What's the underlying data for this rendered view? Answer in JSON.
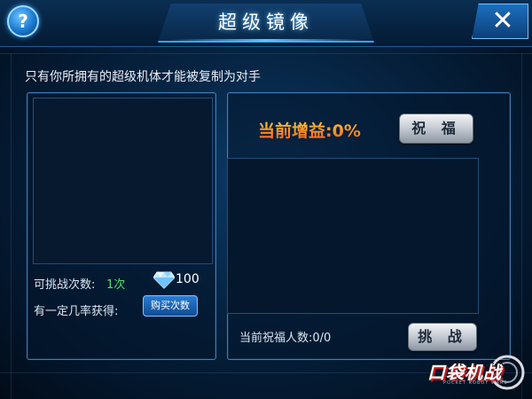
{
  "header": {
    "title": "超级镜像",
    "help_glyph": "?",
    "close_glyph": "✕"
  },
  "subtitle": "只有你所拥有的超级机体才能被复制为对手",
  "left_panel": {
    "challenge_count_label": "可挑战次数:",
    "challenge_count_value": "1次",
    "diamond_cost": "100",
    "probability_label": "有一定几率获得:",
    "buy_button_label": "购买次数"
  },
  "right_panel": {
    "gain_text": "当前增益:0%",
    "bless_button_label": "祝 福",
    "blessing_count_label": "当前祝福人数:0/0",
    "challenge_button_label": "挑 战"
  },
  "logo": {
    "title": "口袋机战",
    "subtitle": "POCKET ROBOT WARS"
  },
  "colors": {
    "accent": "#3da1ff",
    "gain_orange": "#ff7a1a",
    "count_green": "#4fe06a"
  },
  "icons": {
    "help": "help-icon",
    "close": "close-icon",
    "diamond": "diamond-icon"
  }
}
